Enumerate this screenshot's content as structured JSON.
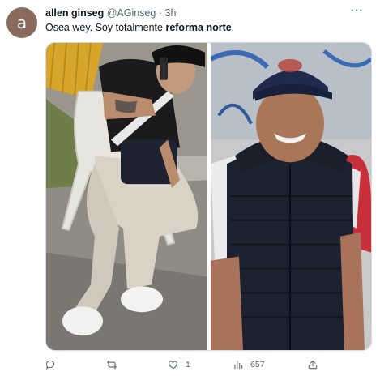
{
  "tweet": {
    "avatar_letter": "a",
    "author_name": "allen ginseg",
    "author_handle": "@AGinseg",
    "separator": "·",
    "time": "3h",
    "more_label": "···",
    "text_prefix": "Osea wey. Soy totalmente ",
    "text_bold": "reforma norte",
    "text_suffix": "."
  },
  "media": {
    "photos": [
      {
        "subject": "man-in-black-cap-on-phone"
      },
      {
        "subject": "young-man-in-cap-and-black-vest"
      }
    ]
  },
  "actions": {
    "reply_count": "",
    "retweet_count": "",
    "like_count": "1",
    "views_count": "657"
  },
  "colors": {
    "text": "#0f1419",
    "muted": "#536471",
    "border": "#cfd9de",
    "avatar_bg": "#8a6a5c"
  }
}
